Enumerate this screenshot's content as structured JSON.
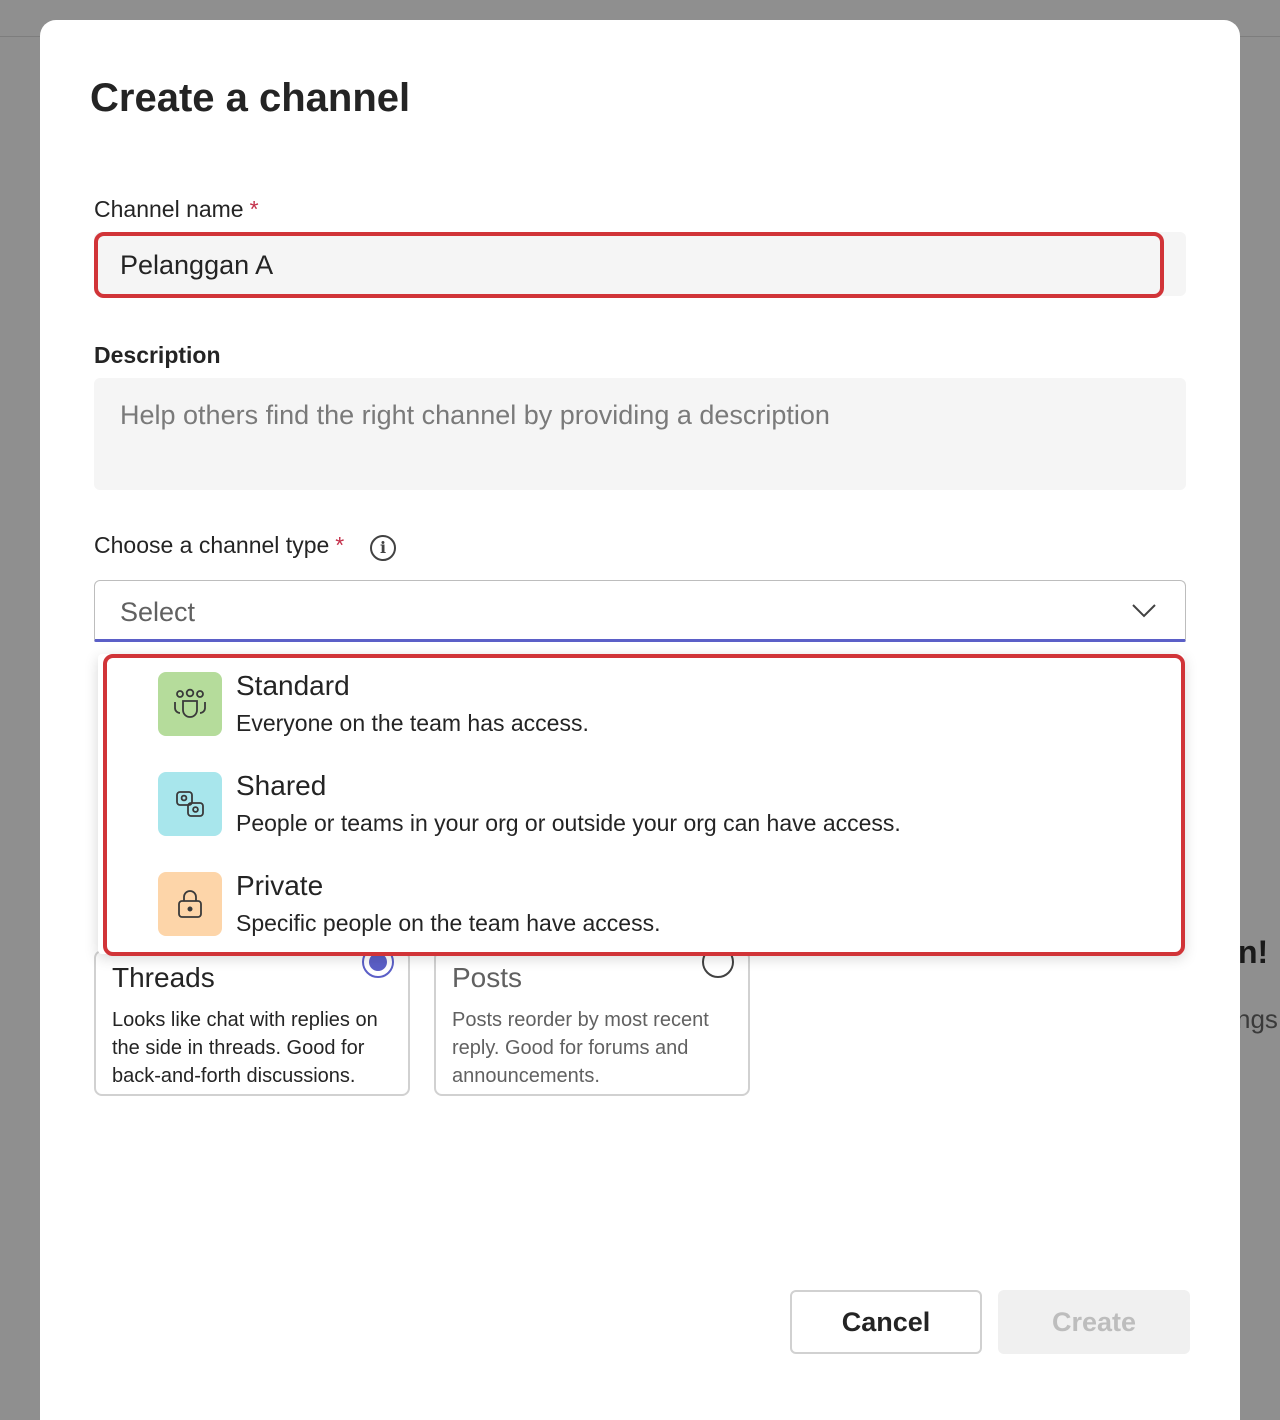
{
  "dialog": {
    "title": "Create a channel",
    "channel_name": {
      "label": "Channel name",
      "required_mark": "*",
      "value": "Pelanggan A"
    },
    "description": {
      "label": "Description",
      "placeholder": "Help others find the right channel by providing a description"
    },
    "channel_type": {
      "label": "Choose a channel type",
      "required_mark": "*",
      "info_icon": "info-icon",
      "selected": "Select",
      "options": [
        {
          "title": "Standard",
          "description": "Everyone on the team has access.",
          "icon": "team-icon",
          "color": "#b5dc9b"
        },
        {
          "title": "Shared",
          "description": "People or teams in your org or outside your org can have access.",
          "icon": "shared-link-icon",
          "color": "#a8e6ec"
        },
        {
          "title": "Private",
          "description": "Specific people on the team have access.",
          "icon": "lock-icon",
          "color": "#fdd5a9"
        }
      ]
    },
    "layout_cards": [
      {
        "title": "Threads",
        "description": "Looks like chat with replies on the side in threads. Good for back-and-forth discussions.",
        "selected": true
      },
      {
        "title": "Posts",
        "description": "Posts reorder by most recent reply. Good for forums and announcements.",
        "selected": false
      }
    ],
    "buttons": {
      "cancel": "Cancel",
      "create": "Create"
    }
  },
  "background": {
    "peek_title": "n!",
    "peek_subtitle": "ngs"
  },
  "colors": {
    "accent": "#5b5fc7",
    "highlight": "#d13438",
    "required": "#c4314b"
  }
}
